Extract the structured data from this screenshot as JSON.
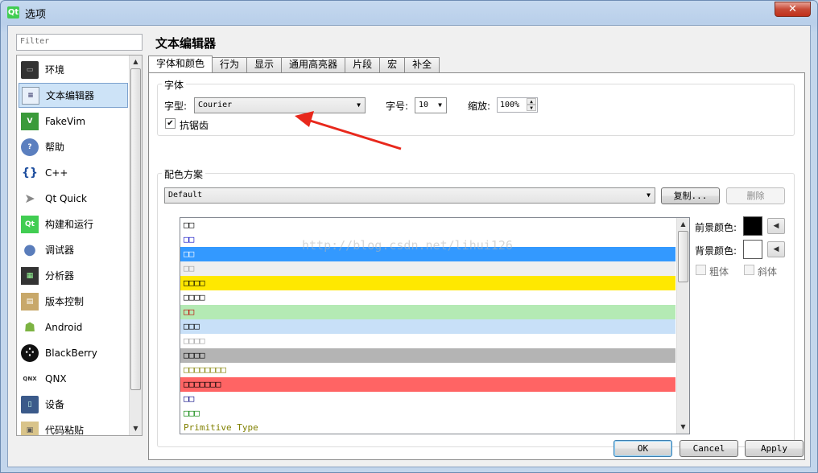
{
  "window": {
    "title": "选项",
    "app_icon": "qt-logo-icon",
    "close_glyph": "✕"
  },
  "filter": {
    "placeholder": "Filter"
  },
  "nav": {
    "items": [
      {
        "label": "环境",
        "icon": "monitor-icon",
        "selected": false
      },
      {
        "label": "文本编辑器",
        "icon": "text-editor-icon",
        "selected": true
      },
      {
        "label": "FakeVim",
        "icon": "fakevim-icon",
        "selected": false
      },
      {
        "label": "帮助",
        "icon": "help-icon",
        "selected": false
      },
      {
        "label": "C++",
        "icon": "braces-icon",
        "selected": false
      },
      {
        "label": "Qt Quick",
        "icon": "paper-plane-icon",
        "selected": false
      },
      {
        "label": "构建和运行",
        "icon": "build-run-icon",
        "selected": false
      },
      {
        "label": "调试器",
        "icon": "debugger-icon",
        "selected": false
      },
      {
        "label": "分析器",
        "icon": "analyzer-icon",
        "selected": false
      },
      {
        "label": "版本控制",
        "icon": "version-control-icon",
        "selected": false
      },
      {
        "label": "Android",
        "icon": "android-icon",
        "selected": false
      },
      {
        "label": "BlackBerry",
        "icon": "blackberry-icon",
        "selected": false
      },
      {
        "label": "QNX",
        "icon": "qnx-icon",
        "selected": false
      },
      {
        "label": "设备",
        "icon": "device-icon",
        "selected": false
      },
      {
        "label": "代码粘贴",
        "icon": "clipboard-icon",
        "selected": false
      }
    ]
  },
  "page": {
    "title": "文本编辑器",
    "tabs": [
      "字体和颜色",
      "行为",
      "显示",
      "通用高亮器",
      "片段",
      "宏",
      "补全"
    ],
    "active_tab": 0
  },
  "font_group": {
    "title": "字体",
    "family_label": "字型:",
    "family_value": "Courier",
    "size_label": "字号:",
    "size_value": "10",
    "zoom_label": "缩放:",
    "zoom_value": "100%",
    "antialias_label": "抗锯齿",
    "antialias_checked": true
  },
  "scheme_group": {
    "title": "配色方案",
    "scheme_value": "Default",
    "copy_label": "复制...",
    "delete_label": "删除"
  },
  "color_rows": [
    {
      "text": "□□",
      "fg": "#000000",
      "bg": "#ffffff"
    },
    {
      "text": "□□",
      "fg": "#0000c0",
      "bg": "#ffffff"
    },
    {
      "text": "□□",
      "fg": "#ffffff",
      "bg": "#3399ff"
    },
    {
      "text": "□□",
      "fg": "#a0a0a0",
      "bg": "#efefef"
    },
    {
      "text": "□□□□",
      "fg": "#000000",
      "bg": "#ffe800"
    },
    {
      "text": "□□□□",
      "fg": "#000000",
      "bg": "#ffffff"
    },
    {
      "text": "□□",
      "fg": "#c00000",
      "bg": "#b4eab4"
    },
    {
      "text": "□□□",
      "fg": "#000000",
      "bg": "#c8e0f8"
    },
    {
      "text": "□□□□",
      "fg": "#a0a0a0",
      "bg": "#ffffff"
    },
    {
      "text": "□□□□",
      "fg": "#000000",
      "bg": "#b4b4b4"
    },
    {
      "text": "□□□□□□□□",
      "fg": "#808000",
      "bg": "#ffffff"
    },
    {
      "text": "□□□□□□□",
      "fg": "#000000",
      "bg": "#ff6464"
    },
    {
      "text": "□□",
      "fg": "#000080",
      "bg": "#ffffff"
    },
    {
      "text": "□□□",
      "fg": "#008000",
      "bg": "#ffffff"
    },
    {
      "text": "Primitive Type",
      "fg": "#808000",
      "bg": "#ffffff"
    }
  ],
  "format_panel": {
    "foreground_label": "前景颜色:",
    "foreground_color": "#000000",
    "background_label": "背景颜色:",
    "background_color": "#ffffff",
    "bold_label": "粗体",
    "italic_label": "斜体"
  },
  "watermark": "http://blog.csdn.net/lihui126",
  "footer": {
    "ok_label": "OK",
    "cancel_label": "Cancel",
    "apply_label": "Apply"
  }
}
